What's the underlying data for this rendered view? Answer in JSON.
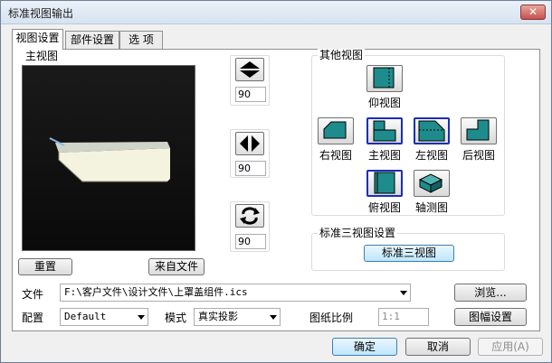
{
  "window": {
    "title": "标准视图输出",
    "close_glyph": "✕"
  },
  "tabs": [
    {
      "label": "视图设置",
      "active": true
    },
    {
      "label": "部件设置",
      "active": false
    },
    {
      "label": "选  项",
      "active": false
    }
  ],
  "main_view": {
    "group_label": "主视图",
    "reset_label": "重置",
    "from_file_label": "来自文件"
  },
  "rotations": {
    "vertical": {
      "value": "90"
    },
    "horizontal": {
      "value": "90"
    },
    "spin": {
      "value": "90"
    }
  },
  "other_views": {
    "group_label": "其他视图",
    "items": [
      {
        "label": "仰视图"
      },
      {
        "label": "右视图"
      },
      {
        "label": "主视图"
      },
      {
        "label": "左视图"
      },
      {
        "label": "后视图"
      },
      {
        "label": "俯视图"
      },
      {
        "label": "轴测图"
      }
    ]
  },
  "standard_three": {
    "group_label": "标准三视图设置",
    "button_label": "标准三视图"
  },
  "file": {
    "label": "文件",
    "value": "F:\\客户文件\\设计文件\\上罩盖组件.ics",
    "browse_label": "浏览..."
  },
  "config": {
    "label": "配置",
    "value": "Default"
  },
  "mode": {
    "label": "模式",
    "value": "真实投影"
  },
  "scale": {
    "label": "图纸比例",
    "value": "1:1"
  },
  "frame_label": "图幅设置",
  "footer": {
    "ok": "确定",
    "cancel": "取消",
    "apply": "应用(A)"
  },
  "colors": {
    "accent": "#1a2fb5",
    "teal": "#1e8c8c"
  }
}
